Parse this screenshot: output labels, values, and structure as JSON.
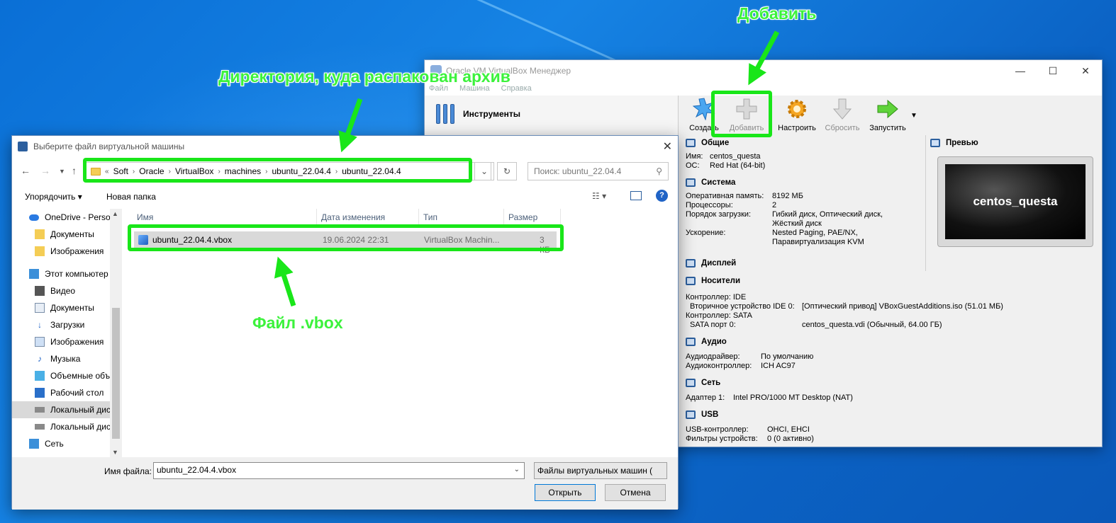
{
  "colors": {
    "annotation": "#19e619",
    "accent": "#2c5f9e"
  },
  "annotations": {
    "add": "Добавить",
    "directory": "Директория, куда распакован архив",
    "file": "Файл .vbox"
  },
  "vbm": {
    "title": "Oracle VM VirtualBox Менеджер",
    "menu": [
      "Файл",
      "Машина",
      "Справка"
    ],
    "tools_label": "Инструменты",
    "toolbar": {
      "create": "Создать",
      "add": "Добавить",
      "settings": "Настроить",
      "discard": "Сбросить",
      "start": "Запустить"
    },
    "general": {
      "title": "Общие",
      "name_label": "Имя:",
      "name_value": "centos_questa",
      "os_label": "ОС:",
      "os_value": "Red Hat (64-bit)"
    },
    "system": {
      "title": "Система",
      "ram_label": "Оперативная память:",
      "ram_value": "8192 МБ",
      "cpu_label": "Процессоры:",
      "cpu_value": "2",
      "boot_label": "Порядок загрузки:",
      "boot_value_1": "Гибкий диск, Оптический диск,",
      "boot_value_2": "Жёсткий диск",
      "accel_label": "Ускорение:",
      "accel_value_1": "Nested Paging, PAE/NX,",
      "accel_value_2": "Паравиртуализация KVM"
    },
    "preview": {
      "title": "Превью",
      "screen_text": "centos_questa"
    },
    "display": {
      "title": "Дисплей"
    },
    "storage": {
      "title": "Носители",
      "ctrl_ide": "Контроллер: IDE",
      "ide_dev_label": "Вторичное устройство IDE 0:",
      "ide_dev_value": "[Оптический привод] VBoxGuestAdditions.iso (51.01 МБ)",
      "ctrl_sata": "Контроллер: SATA",
      "sata_port_label": "SATA порт 0:",
      "sata_port_value": "centos_questa.vdi (Обычный, 64.00 ГБ)"
    },
    "audio": {
      "title": "Аудио",
      "driver_label": "Аудиодрайвер:",
      "driver_value": "По умолчанию",
      "ctrl_label": "Аудиоконтроллер:",
      "ctrl_value": "ICH AC97"
    },
    "network": {
      "title": "Сеть",
      "adapter_label": "Адаптер 1:",
      "adapter_value": "Intel PRO/1000 MT Desktop (NAT)"
    },
    "usb": {
      "title": "USB",
      "ctrl_label": "USB-контроллер:",
      "ctrl_value": "OHCI, EHCI",
      "filters_label": "Фильтры устройств:",
      "filters_value": "0 (0 активно)"
    }
  },
  "dialog": {
    "title": "Выберите файл виртуальной машины",
    "breadcrumb": [
      "«",
      "Soft",
      "Oracle",
      "VirtualBox",
      "machines",
      "ubuntu_22.04.4",
      "ubuntu_22.04.4"
    ],
    "search_placeholder": "Поиск: ubuntu_22.04.4",
    "organize": "Упорядочить",
    "new_folder": "Новая папка",
    "nav": [
      "OneDrive - Persor",
      "Документы",
      "Изображения",
      "Этот компьютер",
      "Видео",
      "Документы",
      "Загрузки",
      "Изображения",
      "Музыка",
      "Объемные объ",
      "Рабочий стол",
      "Локальный дис",
      "Локальный дис",
      "Сеть"
    ],
    "columns": {
      "name": "Имя",
      "date": "Дата изменения",
      "type": "Тип",
      "size": "Размер"
    },
    "file": {
      "name": "ubuntu_22.04.4.vbox",
      "date": "19.06.2024 22:31",
      "type": "VirtualBox Machin...",
      "size": "3 КБ"
    },
    "filename_label": "Имя файла:",
    "filename_value": "ubuntu_22.04.4.vbox",
    "filetype": "Файлы виртуальных машин (",
    "open": "Открыть",
    "cancel": "Отмена"
  }
}
